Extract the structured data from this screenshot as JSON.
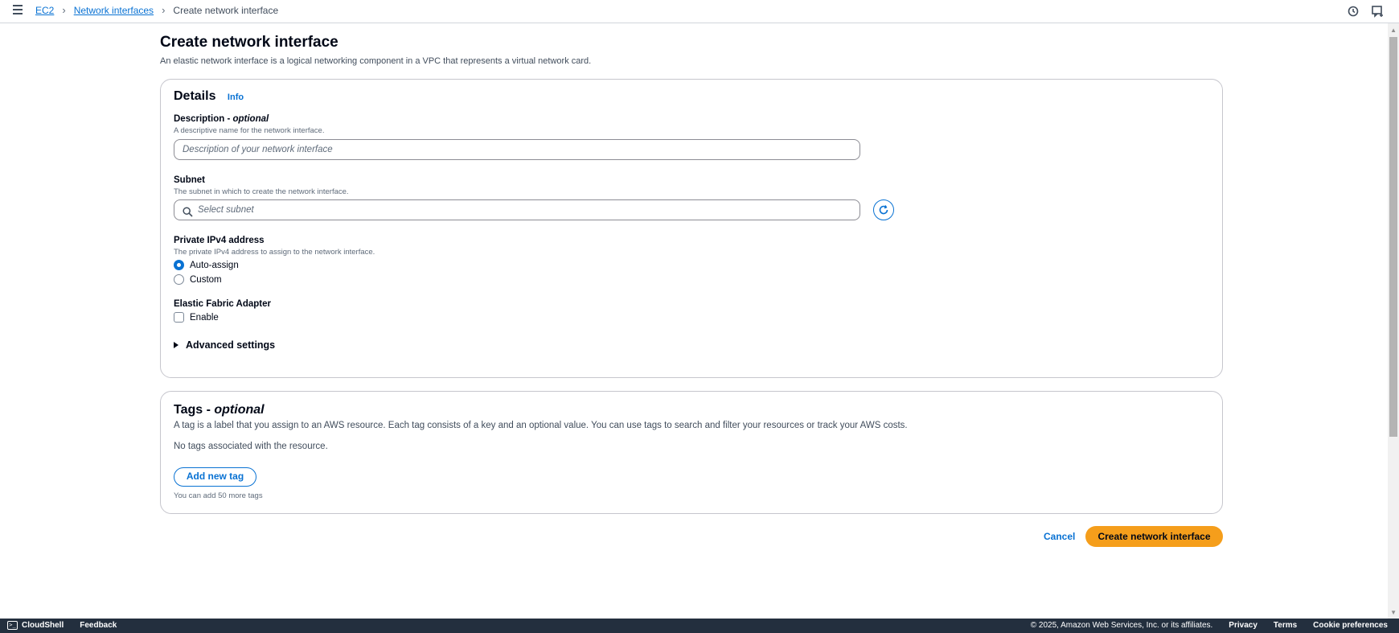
{
  "breadcrumbs": {
    "items": [
      {
        "label": "EC2"
      },
      {
        "label": "Network interfaces"
      }
    ],
    "current": "Create network interface"
  },
  "page": {
    "title": "Create network interface",
    "description": "An elastic network interface is a logical networking component in a VPC that represents a virtual network card."
  },
  "details": {
    "title": "Details",
    "info_label": "Info",
    "description_field": {
      "label": "Description - ",
      "label_optional": "optional",
      "hint": "A descriptive name for the network interface.",
      "placeholder": "Description of your network interface"
    },
    "subnet_field": {
      "label": "Subnet",
      "hint": "The subnet in which to create the network interface.",
      "placeholder": "Select subnet"
    },
    "ipv4_field": {
      "label": "Private IPv4 address",
      "hint": "The private IPv4 address to assign to the network interface.",
      "options": [
        "Auto-assign",
        "Custom"
      ],
      "selected": "Auto-assign"
    },
    "efa_field": {
      "label": "Elastic Fabric Adapter",
      "checkbox_label": "Enable",
      "checked": false
    },
    "advanced_label": "Advanced settings"
  },
  "tags": {
    "title": "Tags - ",
    "title_optional": "optional",
    "description": "A tag is a label that you assign to an AWS resource. Each tag consists of a key and an optional value. You can use tags to search and filter your resources or track your AWS costs.",
    "empty_text": "No tags associated with the resource.",
    "add_button": "Add new tag",
    "remaining_text": "You can add 50 more tags"
  },
  "actions": {
    "cancel": "Cancel",
    "create": "Create network interface"
  },
  "footer": {
    "cloudshell": "CloudShell",
    "feedback": "Feedback",
    "copyright": "© 2025, Amazon Web Services, Inc. or its affiliates.",
    "privacy": "Privacy",
    "terms": "Terms",
    "cookies": "Cookie preferences"
  },
  "colors": {
    "link": "#0972d3",
    "primary_button": "#f59e1b",
    "footer_bg": "#232f3e"
  }
}
